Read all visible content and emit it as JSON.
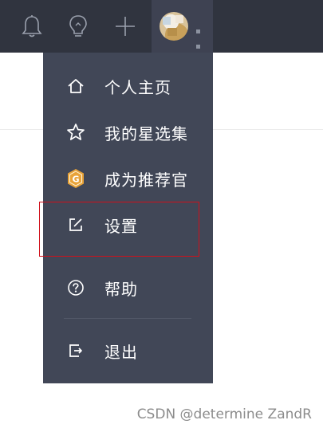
{
  "topbar": {
    "icons": [
      "bell-icon",
      "lightbulb-icon",
      "plus-icon"
    ]
  },
  "menu": {
    "items": [
      {
        "label": "个人主页",
        "icon": "home-icon"
      },
      {
        "label": "我的星选集",
        "icon": "star-icon"
      },
      {
        "label": "成为推荐官",
        "icon": "hexagon-badge-icon"
      },
      {
        "label": "设置",
        "icon": "edit-settings-icon"
      },
      {
        "label": "帮助",
        "icon": "help-circle-icon"
      },
      {
        "label": "退出",
        "icon": "logout-icon"
      }
    ],
    "badge_letter": "G"
  },
  "colors": {
    "topbar_bg": "#30343f",
    "menu_bg": "#414757",
    "badge": "#e8a33a",
    "highlight_border": "#d0101b"
  },
  "watermark": "CSDN @determine  ZandR"
}
